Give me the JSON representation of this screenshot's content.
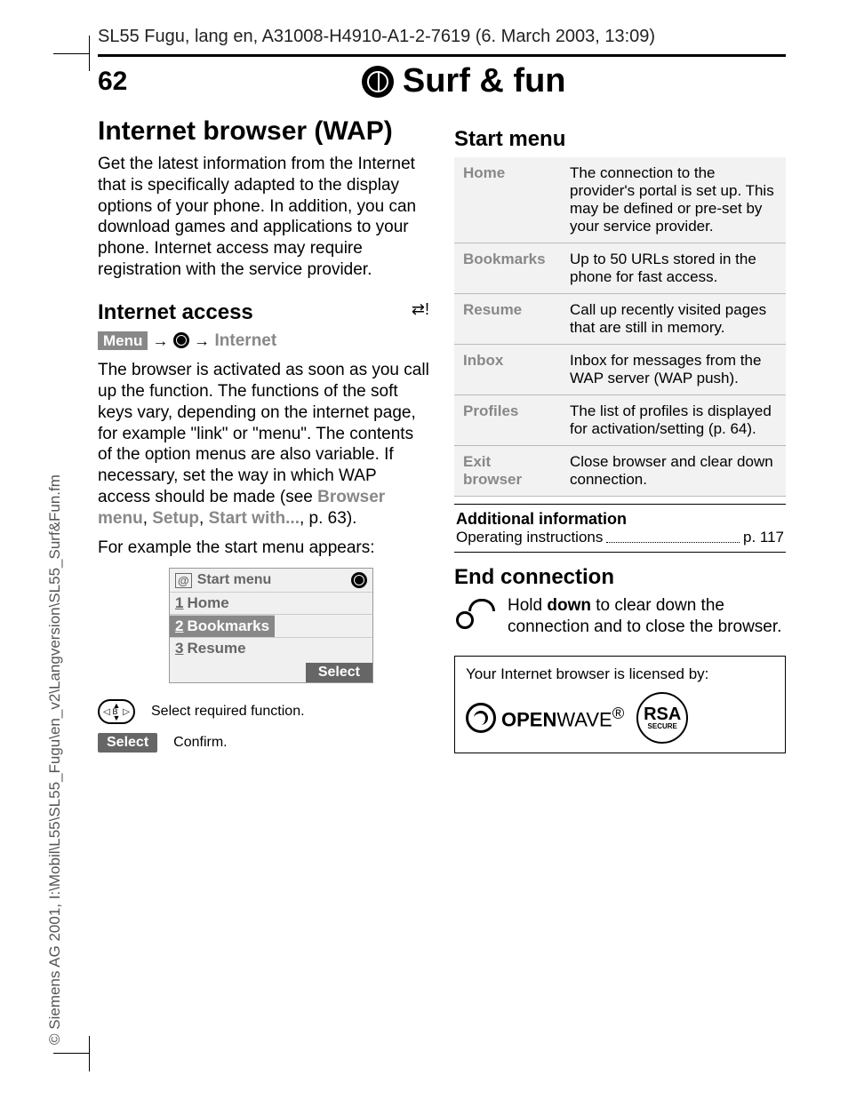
{
  "header": {
    "running_head": "SL55 Fugu, lang en, A31008-H4910-A1-2-7619 (6. March 2003, 13:09)",
    "page_number": "62",
    "page_title": "Surf & fun"
  },
  "sidebar_copyright": "© Siemens AG 2001, I:\\Mobil\\L55\\SL55_Fugu\\en_v2\\Langversion\\SL55_Surf&Fun.fm",
  "left": {
    "h1": "Internet browser (WAP)",
    "intro": "Get the latest information from the Internet that is specifically adapted to the display options of your phone. In addition, you can download games and applications to your phone. Internet access may require registration with the service provider.",
    "h2_access": "Internet access",
    "net_icon_glyph": "⇄!",
    "menu_path": {
      "menu": "Menu",
      "item": "Internet"
    },
    "access_body1": "The browser is activated as soon as you call up the function. The functions of the soft keys vary, depending on the internet page, for example \"link\" or \"menu\". The contents of the option menus are also variable. If necessary, set the way in which WAP access should be made (see ",
    "access_link1": "Browser menu",
    "access_sep1": ", ",
    "access_link2": "Setup",
    "access_sep2": ", ",
    "access_link3": "Start with...",
    "access_tail": ", p. 63).",
    "example_line": "For example the start menu appears:",
    "phone": {
      "title": "Start menu",
      "items": [
        {
          "num": "1",
          "label": "Home"
        },
        {
          "num": "2",
          "label": "Bookmarks"
        },
        {
          "num": "3",
          "label": "Resume"
        }
      ],
      "select": "Select"
    },
    "nav_key_letter": "B",
    "nav_desc": "Select required function.",
    "select_label": "Select",
    "confirm_desc": "Confirm."
  },
  "right": {
    "h2_start": "Start menu",
    "table": [
      {
        "k": "Home",
        "v": "The connection to the provider's portal is set up. This may be defined or pre-set by your service provider."
      },
      {
        "k": "Bookmarks",
        "v": "Up to 50 URLs stored in the phone for fast access."
      },
      {
        "k": "Resume",
        "v": "Call up recently visited pages that are still in memory."
      },
      {
        "k": "Inbox",
        "v": "Inbox for messages from the WAP server (WAP push)."
      },
      {
        "k": "Profiles",
        "v": "The list of profiles is displayed for activation/setting (p. 64)."
      },
      {
        "k": "Exit browser",
        "v": "Close browser and clear down connection."
      }
    ],
    "addl_title": "Additional information",
    "addl_item": "Operating instructions",
    "addl_page": "p. 117",
    "h2_end": "End connection",
    "end_body_pre": "Hold ",
    "end_body_bold": "down",
    "end_body_post": " to clear down the connection and to close the browser.",
    "license_text": "Your Internet browser is licensed by:",
    "openwave_bold": "OPEN",
    "openwave_light": "WAVE",
    "rsa_label": "RSA",
    "rsa_sub": "SECURE"
  }
}
